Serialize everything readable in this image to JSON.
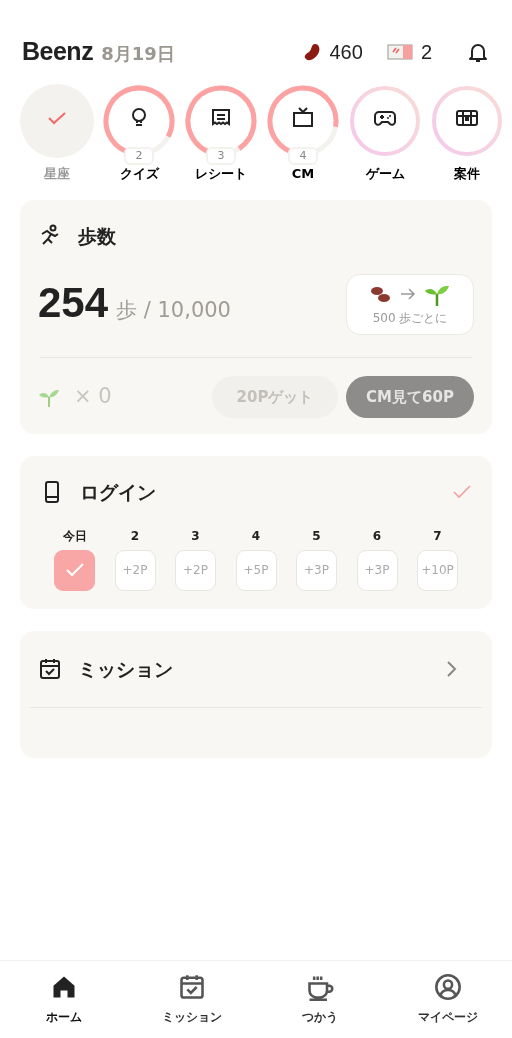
{
  "header": {
    "title": "Beenz",
    "date": "8月19日",
    "beans": "460",
    "tickets": "2"
  },
  "shortcuts": [
    {
      "label": "星座",
      "kind": "done"
    },
    {
      "label": "クイズ",
      "kind": "progress",
      "count": "2"
    },
    {
      "label": "レシート",
      "kind": "progress",
      "count": "3"
    },
    {
      "label": "CM",
      "kind": "progress",
      "count": "4"
    },
    {
      "label": "ゲーム",
      "kind": "gradient"
    },
    {
      "label": "案件",
      "kind": "gradient"
    }
  ],
  "steps": {
    "title": "歩数",
    "count": "254",
    "unit": "歩 / 10,000",
    "reward_note": "500 歩ごとに",
    "sprouts": "× 0",
    "buttons": [
      {
        "label": "20Pゲット",
        "disabled": true
      },
      {
        "label": "CM見て60P",
        "disabled": false
      }
    ]
  },
  "login": {
    "title": "ログイン",
    "done": true,
    "days": [
      {
        "label": "今日",
        "checked": true
      },
      {
        "label": "2",
        "reward": "+2P",
        "checked": false
      },
      {
        "label": "3",
        "reward": "+2P",
        "checked": false
      },
      {
        "label": "4",
        "reward": "+5P",
        "checked": false
      },
      {
        "label": "5",
        "reward": "+3P",
        "checked": false
      },
      {
        "label": "6",
        "reward": "+3P",
        "checked": false
      },
      {
        "label": "7",
        "reward": "+10P",
        "checked": false
      }
    ]
  },
  "mission": {
    "title": "ミッション"
  },
  "tabbar": [
    {
      "label": "ホーム",
      "selected": true
    },
    {
      "label": "ミッション",
      "selected": false
    },
    {
      "label": "つかう",
      "selected": false
    },
    {
      "label": "マイページ",
      "selected": false
    }
  ]
}
